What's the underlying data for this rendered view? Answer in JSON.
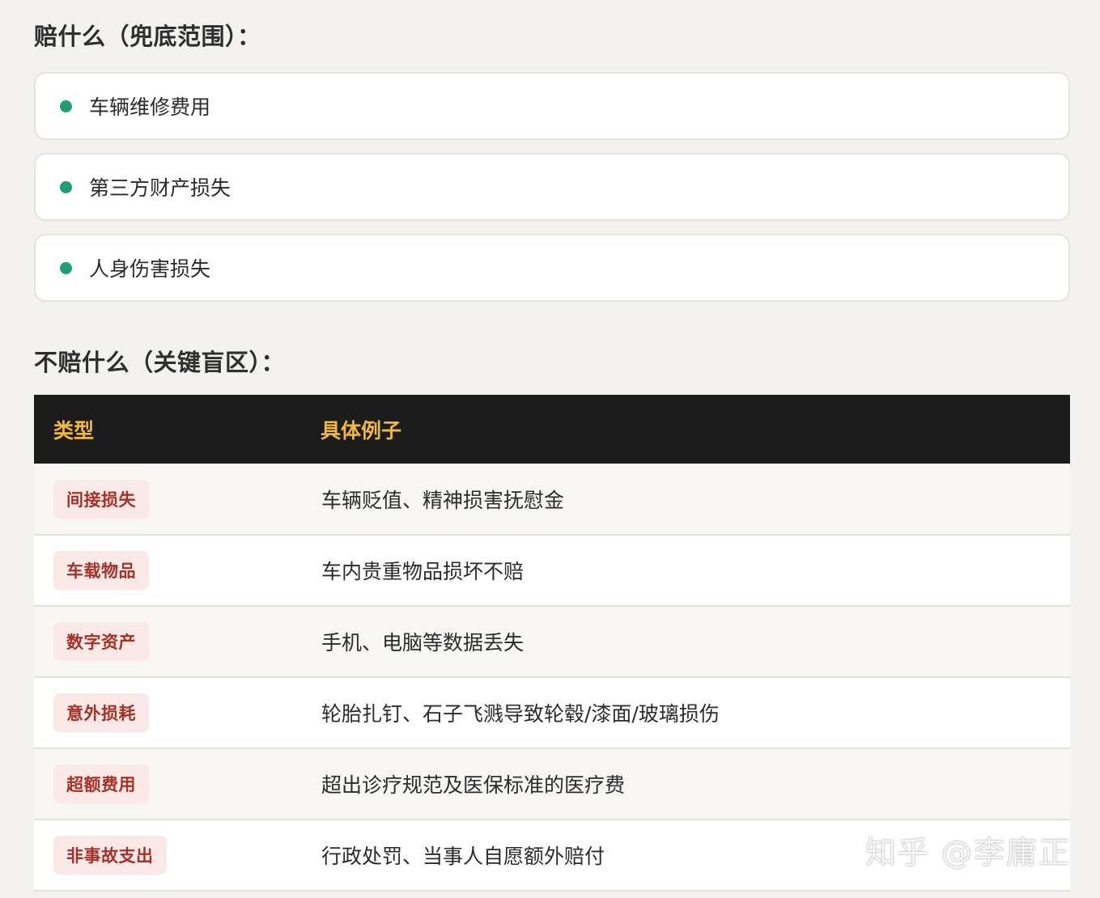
{
  "covered": {
    "title": "赔什么（兜底范围）：",
    "items": [
      {
        "icon": "bullet-dot-icon",
        "text": "车辆维修费用"
      },
      {
        "icon": "bullet-dot-icon",
        "text": "第三方财产损失"
      },
      {
        "icon": "bullet-dot-icon",
        "text": "人身伤害损失"
      }
    ],
    "dot_color": "#1f9d74"
  },
  "excluded": {
    "title": "不赔什么（关键盲区）：",
    "headers": {
      "type": "类型",
      "example": "具体例子"
    },
    "rows": [
      {
        "type": "间接损失",
        "example": "车辆贬值、精神损害抚慰金"
      },
      {
        "type": "车载物品",
        "example": "车内贵重物品损坏不赔"
      },
      {
        "type": "数字资产",
        "example": "手机、电脑等数据丢失"
      },
      {
        "type": "意外损耗",
        "example": "轮胎扎钉、石子飞溅导致轮毂/漆面/玻璃损伤"
      },
      {
        "type": "超额费用",
        "example": "超出诊疗规范及医保标准的医疗费"
      },
      {
        "type": "非事故支出",
        "example": "行政处罚、当事人自愿额外赔付"
      }
    ],
    "header_bg": "#1c1c1c",
    "header_text_color": "#f0b93a",
    "badge_bg": "#fbe9e7",
    "badge_text_color": "#a63128"
  },
  "watermark": "知乎 @李庸正"
}
